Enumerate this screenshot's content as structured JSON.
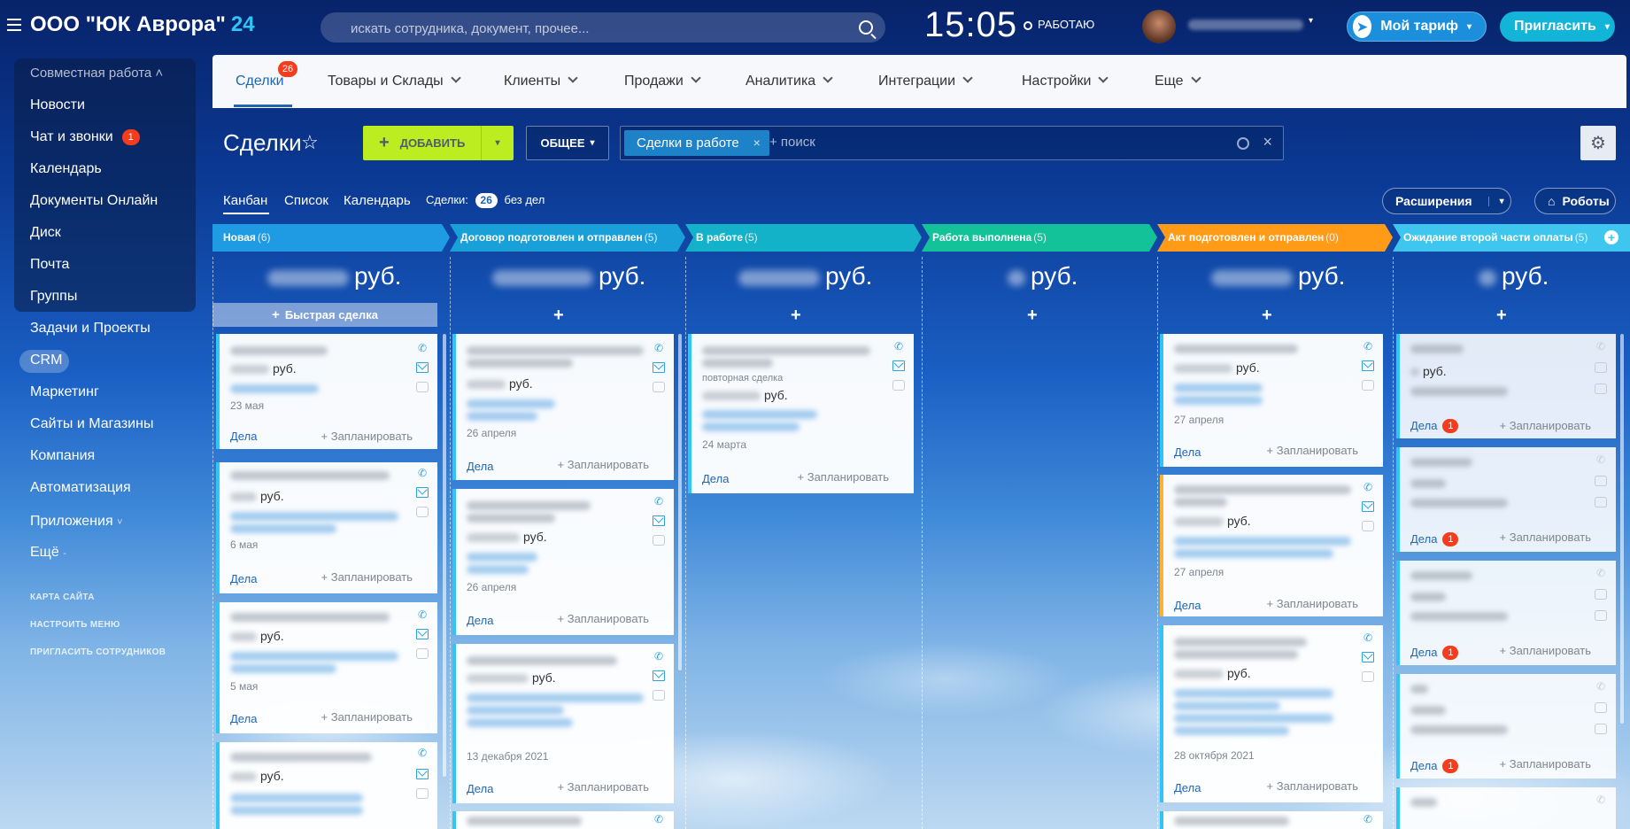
{
  "header": {
    "portal_name": "ООО \"ЮК Аврора\"",
    "portal_suffix": "24",
    "search_placeholder": "искать сотрудника, документ, прочее...",
    "time": "15:05",
    "work_status": "РАБОТАЮ",
    "tariff_label": "Мой тариф",
    "invite_label": "Пригласить"
  },
  "leftmenu": {
    "group_title": "Совместная работа",
    "items": [
      {
        "label": "Новости"
      },
      {
        "label": "Чат и звонки",
        "counter": "1"
      },
      {
        "label": "Календарь"
      },
      {
        "label": "Документы Онлайн"
      },
      {
        "label": "Диск"
      },
      {
        "label": "Почта"
      },
      {
        "label": "Группы"
      }
    ],
    "items2": [
      {
        "label": "Задачи и Проекты"
      },
      {
        "label": "CRM"
      },
      {
        "label": "Маркетинг"
      },
      {
        "label": "Сайты и Магазины"
      },
      {
        "label": "Компания"
      },
      {
        "label": "Автоматизация"
      },
      {
        "label": "Приложения"
      },
      {
        "label": "Ещё"
      }
    ],
    "links": [
      "КАРТА САЙТА",
      "НАСТРОИТЬ МЕНЮ",
      "ПРИГЛАСИТЬ СОТРУДНИКОВ"
    ]
  },
  "tabs": {
    "items": [
      "Сделки",
      "Товары и Склады",
      "Клиенты",
      "Продажи",
      "Аналитика",
      "Интеграции",
      "Настройки",
      "Еще"
    ],
    "badge": "26"
  },
  "toolbar": {
    "title": "Сделки",
    "add_label": "ДОБАВИТЬ",
    "category_label": "ОБЩЕЕ",
    "filter_chip": "Сделки в работе",
    "filter_search_placeholder": "+ поиск",
    "views": [
      "Канбан",
      "Список",
      "Календарь"
    ],
    "deals_label": "Сделки:",
    "deals_count": "26",
    "deals_suffix": "без дел",
    "extensions_label": "Расширения",
    "robots_label": "Роботы"
  },
  "kanban": {
    "currency": "руб.",
    "quick_deal_label": "Быстрая сделка",
    "deals_link": "Дела",
    "plan_link": "+ Запланировать",
    "repeat_deal": "повторная сделка",
    "columns": [
      {
        "name": "Новая",
        "count": "(6)",
        "color": "#1f9be3"
      },
      {
        "name": "Договор подготовлен и отправлен",
        "count": "(5)",
        "color": "#1aa0d8"
      },
      {
        "name": "В работе",
        "count": "(5)",
        "color": "#14b2c9"
      },
      {
        "name": "Работа выполнена",
        "count": "(5)",
        "color": "#14c29a"
      },
      {
        "name": "Акт подготовлен и отправлен",
        "count": "(0)",
        "color": "#ff9b17"
      },
      {
        "name": "Ожидание второй части оплаты",
        "count": "(5)",
        "color": "#3fc6ef"
      }
    ],
    "cards": {
      "c1": [
        "23 мая",
        "6 мая",
        "5 мая"
      ],
      "c2": [
        "26 апреля",
        "26 апреля",
        "13 декабря 2021"
      ],
      "c3": [
        "24 марта"
      ],
      "c5": [
        "27 апреля",
        "27 апреля",
        "28 октября 2021"
      ],
      "c6_badge": "1"
    }
  }
}
